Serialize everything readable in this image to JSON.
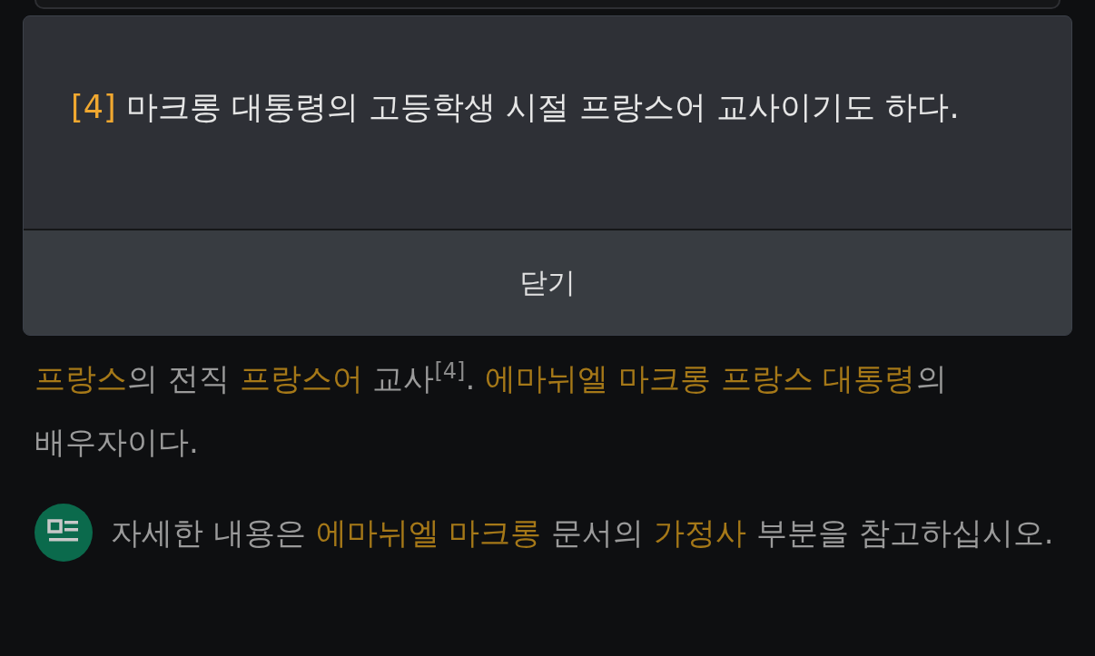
{
  "footnote_popup": {
    "marker": "[4]",
    "text": "마크롱 대통령의 고등학생 시절 프랑스어 교사이기도 하다.",
    "close_button": "닫기"
  },
  "article": {
    "paragraph": [
      {
        "kind": "link",
        "text": "프랑스"
      },
      {
        "kind": "text",
        "text": "의 전직 "
      },
      {
        "kind": "link",
        "text": "프랑스어"
      },
      {
        "kind": "text",
        "text": " 교사"
      },
      {
        "kind": "footnote",
        "text": "[4]"
      },
      {
        "kind": "text",
        "text": ". "
      },
      {
        "kind": "link",
        "text": "에마뉘엘 마크롱 프랑스 대통령"
      },
      {
        "kind": "text",
        "text": "의 배우자이다."
      }
    ],
    "note": [
      {
        "kind": "text",
        "text": "자세한 내용은 "
      },
      {
        "kind": "link",
        "text": "에마뉘엘 마크롱"
      },
      {
        "kind": "text",
        "text": " 문서의 "
      },
      {
        "kind": "link",
        "text": "가정사"
      },
      {
        "kind": "text",
        "text": " 부분을 참고하십시오."
      }
    ]
  }
}
